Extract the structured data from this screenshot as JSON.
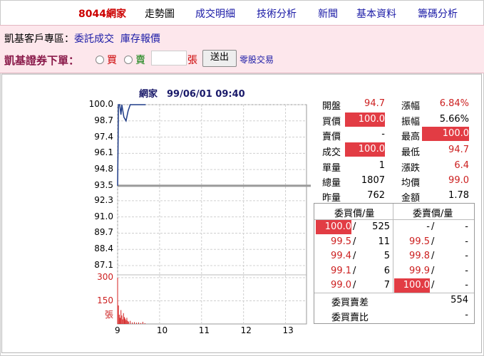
{
  "nav": {
    "title": "8044網家",
    "items": [
      "走勢圖",
      "成交明細",
      "技術分析",
      "新聞",
      "基本資料",
      "籌碼分析"
    ]
  },
  "client_zone": {
    "label": "凱基客戶專區：",
    "link1": "委託成交",
    "link2": "庫存報價"
  },
  "order": {
    "label": "凱基證券下單：",
    "buy": "買",
    "sell": "賣",
    "unit": "張",
    "submit": "送出",
    "odd_lot": "零股交易"
  },
  "chart_header": "網家　99/06/01 09:40",
  "chart_data": {
    "type": "line",
    "price_ticks": [
      "100.0",
      "98.7",
      "97.4",
      "96.1",
      "94.8",
      "93.5",
      "92.3",
      "91.0",
      "89.7",
      "88.4",
      "87.1"
    ],
    "reference_price": 93.5,
    "ylim": [
      87.1,
      100.0
    ],
    "volume_ticks": [
      "300",
      "150",
      "張"
    ],
    "x_ticks": [
      "9",
      "10",
      "11",
      "12",
      "13"
    ],
    "price_series": [
      [
        9.0,
        93.5
      ],
      [
        9.01,
        96.5
      ],
      [
        9.02,
        100.0
      ],
      [
        9.05,
        100.0
      ],
      [
        9.08,
        99.2
      ],
      [
        9.1,
        100.0
      ],
      [
        9.15,
        99.0
      ],
      [
        9.2,
        98.7
      ],
      [
        9.25,
        99.5
      ],
      [
        9.3,
        100.0
      ],
      [
        9.4,
        100.0
      ],
      [
        9.5,
        100.0
      ],
      [
        9.55,
        100.0
      ],
      [
        9.6,
        100.0
      ],
      [
        9.667,
        100.0
      ]
    ],
    "volume_series": [
      [
        9.0,
        300
      ],
      [
        9.02,
        120
      ],
      [
        9.04,
        60
      ],
      [
        9.06,
        40
      ],
      [
        9.08,
        90
      ],
      [
        9.1,
        55
      ],
      [
        9.12,
        30
      ],
      [
        9.14,
        70
      ],
      [
        9.16,
        45
      ],
      [
        9.18,
        35
      ],
      [
        9.2,
        25
      ],
      [
        9.22,
        40
      ],
      [
        9.24,
        20
      ],
      [
        9.26,
        15
      ],
      [
        9.3,
        20
      ],
      [
        9.35,
        10
      ],
      [
        9.4,
        12
      ],
      [
        9.45,
        8
      ],
      [
        9.5,
        10
      ],
      [
        9.55,
        6
      ],
      [
        9.6,
        14
      ],
      [
        9.65,
        5
      ]
    ]
  },
  "quote": {
    "open_label": "開盤",
    "open": "94.7",
    "change_pct_label": "漲幅",
    "change_pct": "6.84%",
    "bid_label": "買價",
    "bid": "100.0",
    "amplitude_label": "振幅",
    "amplitude": "5.66%",
    "ask_label": "賣價",
    "ask": "-",
    "high_label": "最高",
    "high": "100.0",
    "last_label": "成交",
    "last": "100.0",
    "low_label": "最低",
    "low": "94.7",
    "single_label": "單量",
    "single": "1",
    "change_label": "漲跌",
    "change": "6.4",
    "total_label": "總量",
    "total": "1807",
    "avg_label": "均價",
    "avg": "99.0",
    "prev_label": "昨量",
    "prev": "762",
    "amount_label": "金額",
    "amount": "1.78"
  },
  "orderbook": {
    "bid_header": "委買價/量",
    "ask_header": "委賣價/量",
    "rows": [
      {
        "bid_price": "100.0",
        "bid_qty": "525",
        "ask_price": "-",
        "ask_qty": "-"
      },
      {
        "bid_price": "99.5",
        "bid_qty": "11",
        "ask_price": "99.5",
        "ask_qty": "-"
      },
      {
        "bid_price": "99.4",
        "bid_qty": "5",
        "ask_price": "99.8",
        "ask_qty": "-"
      },
      {
        "bid_price": "99.1",
        "bid_qty": "6",
        "ask_price": "99.9",
        "ask_qty": "-"
      },
      {
        "bid_price": "99.0",
        "bid_qty": "7",
        "ask_price": "100.0",
        "ask_qty": "-"
      }
    ],
    "diff_label": "委買賣差",
    "diff": "554",
    "ratio_label": "委買賣比",
    "ratio": "-"
  },
  "colors": {
    "price_line": "#1f3c88",
    "volume_bar": "#d42020",
    "ref_line": "#9a9a9a",
    "highlight": "#e23c44"
  }
}
